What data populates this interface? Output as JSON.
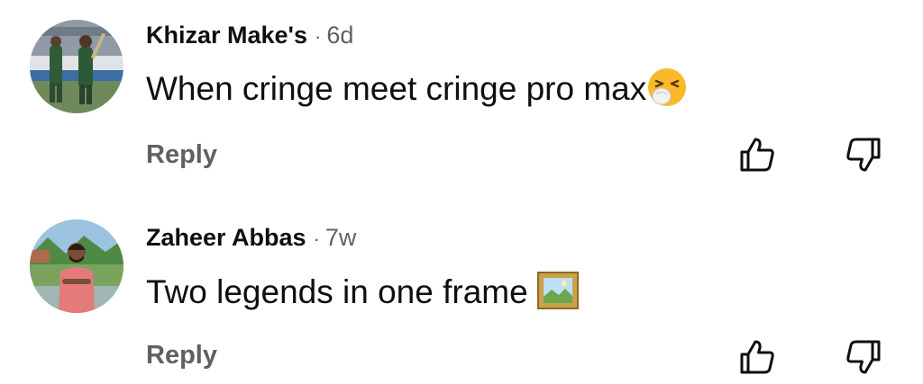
{
  "comments": [
    {
      "author": "Khizar Make's",
      "separator": "·",
      "age": "6d",
      "text": "When cringe meet cringe pro max",
      "emoji": "sneezing-face-emoji",
      "reply_label": "Reply"
    },
    {
      "author": "Zaheer Abbas",
      "separator": "·",
      "age": "7w",
      "text": "Two legends in one frame ",
      "emoji": "framed-picture-emoji",
      "reply_label": "Reply"
    }
  ],
  "colors": {
    "text_primary": "#0f0f0f",
    "text_secondary": "#606060",
    "background": "#ffffff"
  },
  "icons": [
    "thumbs-up-icon",
    "thumbs-down-icon"
  ]
}
